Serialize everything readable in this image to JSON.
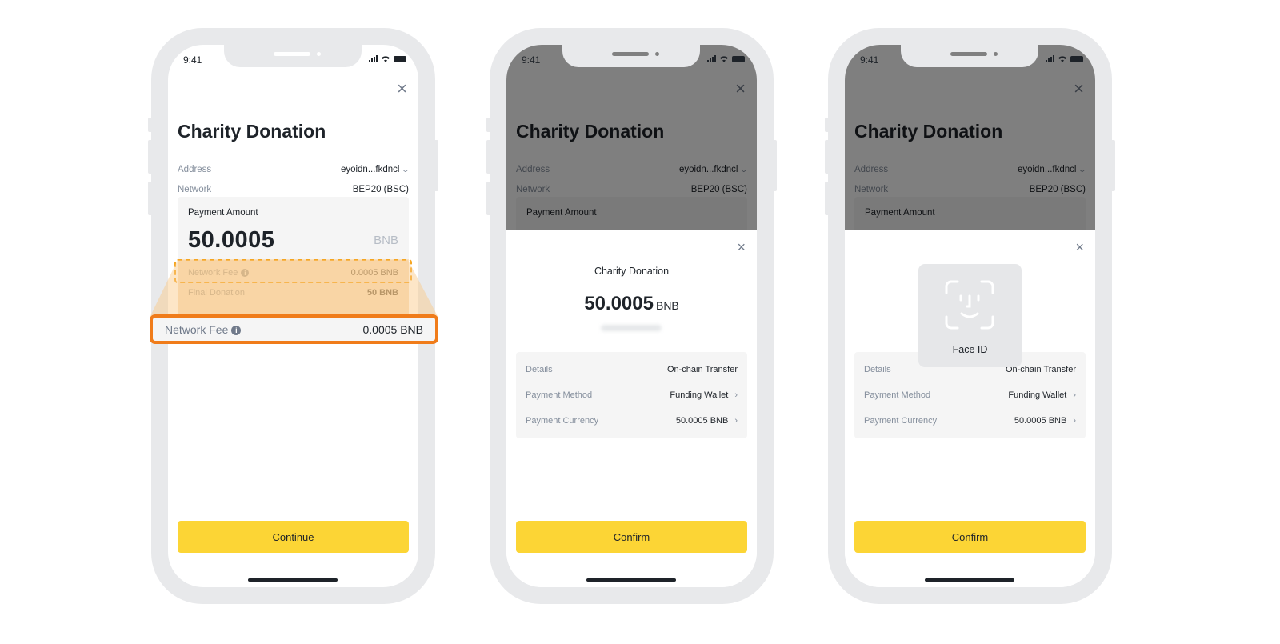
{
  "status_bar": {
    "time": "9:41"
  },
  "phones": [
    {
      "title": "Charity Donation",
      "address_label": "Address",
      "address_value": "eyoidn...fkdncl",
      "network_label": "Network",
      "network_value": "BEP20 (BSC)",
      "payment_amount_label": "Payment Amount",
      "payment_amount": "50.0005",
      "payment_unit": "BNB",
      "network_fee_label": "Network Fee",
      "network_fee_value": "0.0005 BNB",
      "final_donation_label": "Final Donation",
      "final_donation_value": "50 BNB",
      "button_label": "Continue"
    },
    {
      "title": "Charity Donation",
      "address_label": "Address",
      "address_value": "eyoidn...fkdncl",
      "network_label": "Network",
      "network_value": "BEP20 (BSC)",
      "payment_amount_label": "Payment Amount",
      "sheet": {
        "title": "Charity Donation",
        "amount": "50.0005",
        "unit": "BNB",
        "details": [
          {
            "label": "Details",
            "value": "On-chain Transfer"
          },
          {
            "label": "Payment Method",
            "value": "Funding Wallet"
          },
          {
            "label": "Payment Currency",
            "value": "50.0005 BNB"
          }
        ]
      },
      "button_label": "Confirm"
    },
    {
      "title": "Charity Donation",
      "address_label": "Address",
      "address_value": "eyoidn...fkdncl",
      "network_label": "Network",
      "network_value": "BEP20 (BSC)",
      "payment_amount_label": "Payment Amount",
      "faceid_label": "Face ID",
      "sheet": {
        "details": [
          {
            "label": "Details",
            "value": "On-chain Transfer"
          },
          {
            "label": "Payment Method",
            "value": "Funding Wallet"
          },
          {
            "label": "Payment Currency",
            "value": "50.0005 BNB"
          }
        ]
      },
      "button_label": "Confirm"
    }
  ],
  "callout": {
    "label": "Network Fee",
    "value": "0.0005 BNB",
    "border_color": "#f07c1a"
  },
  "colors": {
    "accent": "#fcd535",
    "highlight": "#f5a623"
  },
  "icons": {
    "close": "×",
    "chevron_down": "⌄",
    "chevron_right": "›",
    "info": "i"
  }
}
